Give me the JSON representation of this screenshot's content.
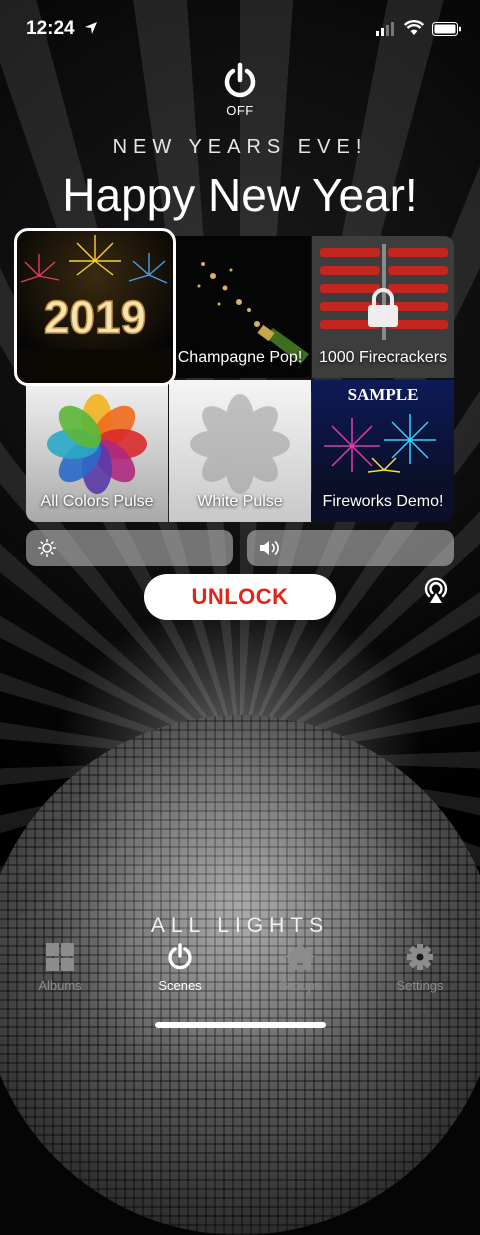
{
  "status": {
    "time": "12:24"
  },
  "power": {
    "label": "OFF"
  },
  "header": {
    "subtitle": "NEW YEARS EVE!",
    "title": "Happy New Year!"
  },
  "tiles": [
    {
      "label": "",
      "image_text": "2019",
      "selected": true
    },
    {
      "label": "Champagne Pop!"
    },
    {
      "label": "1000 Firecrackers",
      "locked": true
    },
    {
      "label": "All Colors Pulse"
    },
    {
      "label": "White Pulse"
    },
    {
      "label": "Fireworks Demo!",
      "image_text": "SAMPLE"
    }
  ],
  "controls": {
    "unlock_label": "UNLOCK"
  },
  "footer": {
    "group_label": "ALL LIGHTS"
  },
  "tabs": [
    {
      "label": "Albums",
      "icon": "grid-icon"
    },
    {
      "label": "Scenes",
      "icon": "power-icon",
      "active": true
    },
    {
      "label": "Groups",
      "icon": "house-icon"
    },
    {
      "label": "Settings",
      "icon": "gear-icon"
    }
  ],
  "colors": {
    "accent": "#e0261b",
    "active_tab": "#ffffff",
    "inactive_tab": "#8c8c8c"
  }
}
